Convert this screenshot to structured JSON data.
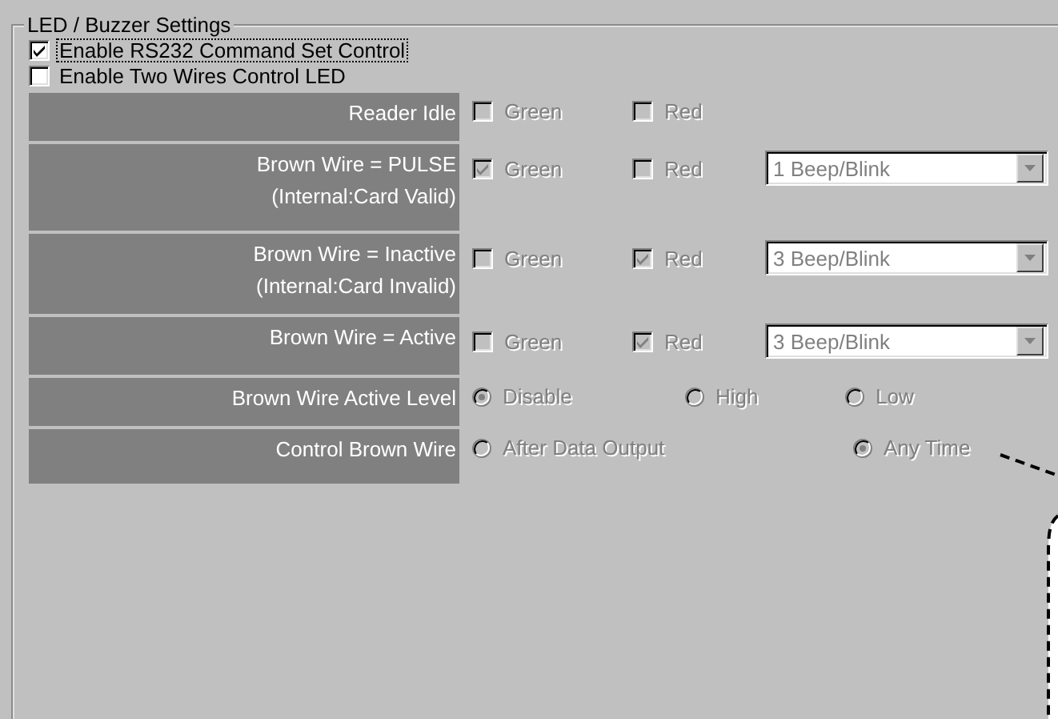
{
  "group": {
    "title": "LED / Buzzer Settings"
  },
  "options": [
    {
      "label": "Enable RS232 Command Set Control",
      "checked": true,
      "focused": true
    },
    {
      "label": "Enable Two Wires Control LED",
      "checked": false,
      "focused": false
    }
  ],
  "rows": [
    {
      "kind": "checks",
      "label": [
        "Reader Idle"
      ],
      "disabled": true,
      "options": [
        {
          "label": "Green",
          "checked": false
        },
        {
          "label": "Red",
          "checked": false
        }
      ]
    },
    {
      "kind": "checks",
      "label": [
        "Brown Wire = PULSE",
        "(Internal:Card Valid)"
      ],
      "disabled": true,
      "options": [
        {
          "label": "Green",
          "checked": true
        },
        {
          "label": "Red",
          "checked": false
        }
      ],
      "dropdown": {
        "value": "1 Beep/Blink"
      }
    },
    {
      "kind": "checks",
      "label": [
        "Brown Wire = Inactive",
        "(Internal:Card Invalid)"
      ],
      "disabled": true,
      "options": [
        {
          "label": "Green",
          "checked": false
        },
        {
          "label": "Red",
          "checked": true
        }
      ],
      "dropdown": {
        "value": "3 Beep/Blink"
      }
    },
    {
      "kind": "checks",
      "label": [
        "Brown Wire = Active"
      ],
      "disabled": true,
      "options": [
        {
          "label": "Green",
          "checked": false
        },
        {
          "label": "Red",
          "checked": true
        }
      ],
      "dropdown": {
        "value": "3 Beep/Blink"
      }
    },
    {
      "kind": "radios",
      "label": [
        "Brown Wire Active Level"
      ],
      "disabled": true,
      "options": [
        {
          "label": "Disable",
          "selected": true
        },
        {
          "label": "High",
          "selected": false
        },
        {
          "label": "Low",
          "selected": false
        }
      ]
    },
    {
      "kind": "radios",
      "label": [
        "Control Brown Wire"
      ],
      "disabled": true,
      "options": [
        {
          "label": "After Data Output",
          "selected": false
        },
        {
          "label": "Any Time",
          "selected": true
        }
      ]
    }
  ]
}
